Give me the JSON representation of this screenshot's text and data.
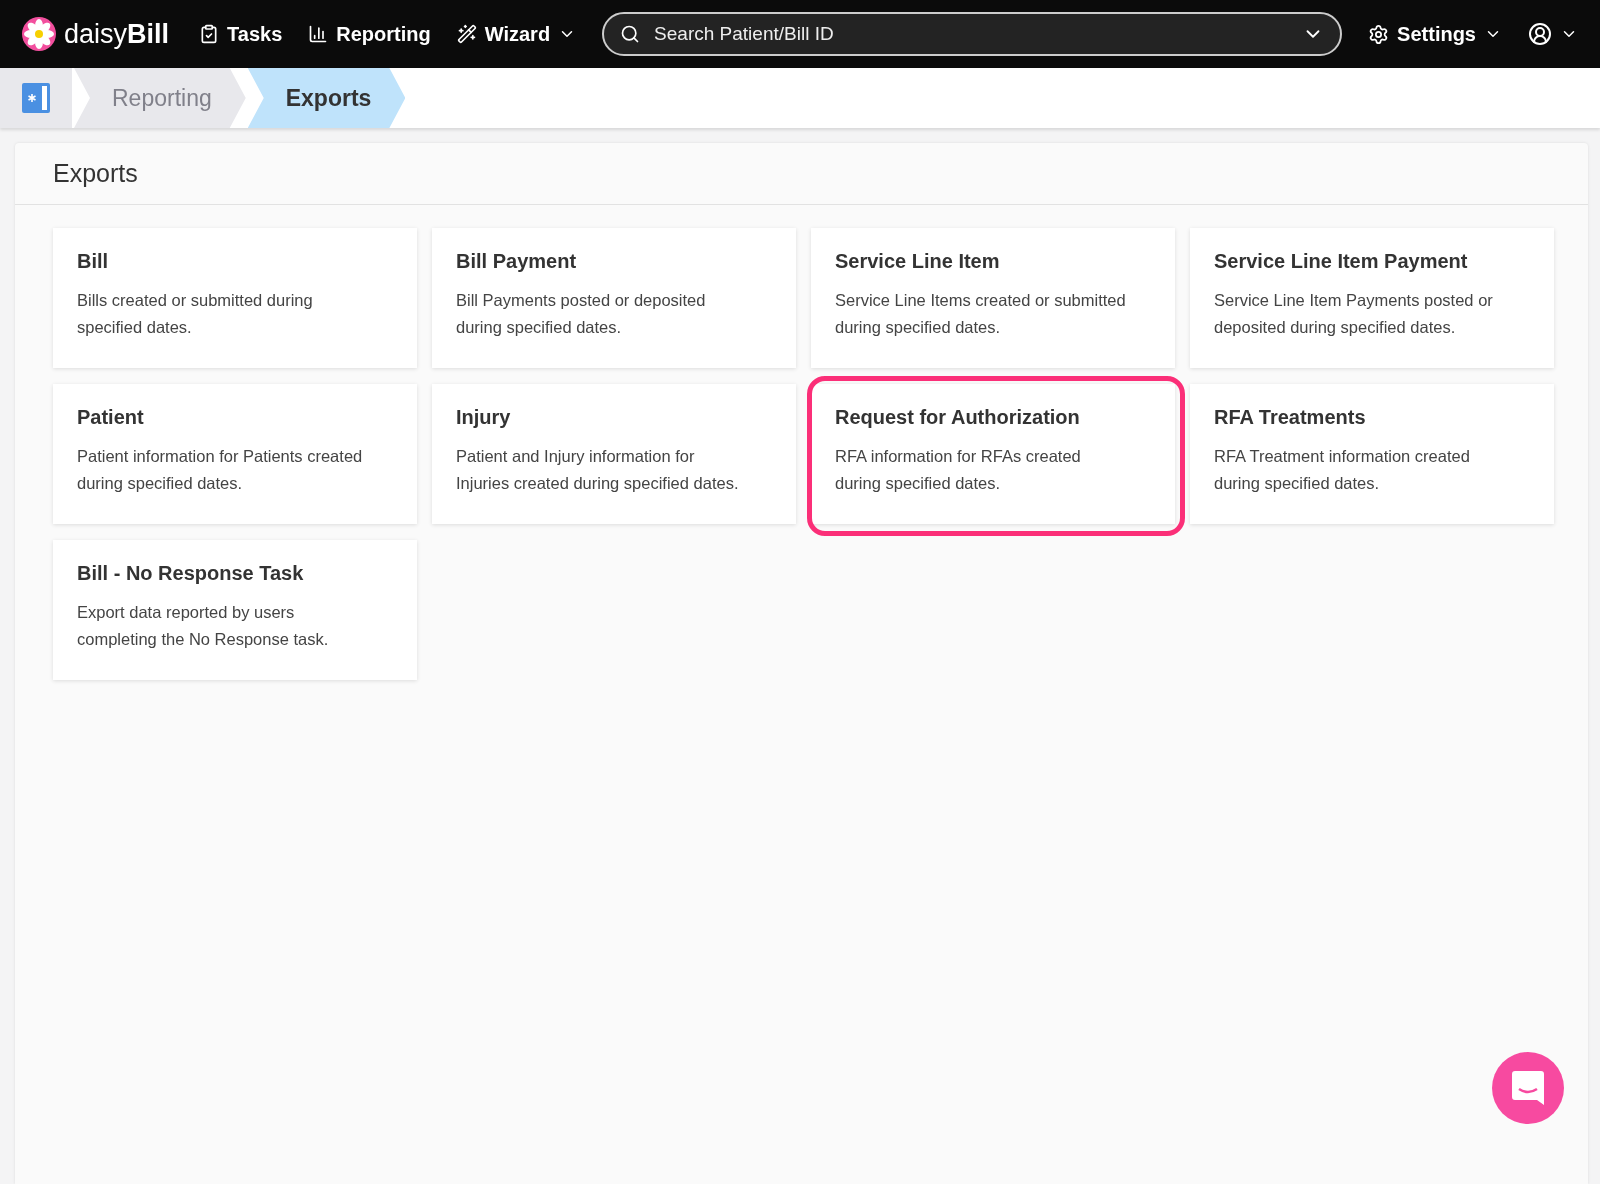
{
  "brand": {
    "light": "daisy",
    "bold": "Bill"
  },
  "nav": [
    {
      "label": "Tasks",
      "caret": false
    },
    {
      "label": "Reporting",
      "caret": false
    },
    {
      "label": "Wizard",
      "caret": true
    }
  ],
  "search": {
    "placeholder": "Search Patient/Bill ID"
  },
  "settings": {
    "label": "Settings"
  },
  "breadcrumbs": [
    {
      "label": "Reporting",
      "selected": false
    },
    {
      "label": "Exports",
      "selected": true
    }
  ],
  "panel": {
    "title": "Exports"
  },
  "cards": [
    {
      "title": "Bill",
      "description": "Bills created or submitted during specified dates.",
      "highlighted": false
    },
    {
      "title": "Bill Payment",
      "description": "Bill Payments posted or deposited during specified dates.",
      "highlighted": false
    },
    {
      "title": "Service Line Item",
      "description": "Service Line Items created or submitted during specified dates.",
      "highlighted": false
    },
    {
      "title": "Service Line Item Payment",
      "description": "Service Line Item Payments posted or deposited during specified dates.",
      "highlighted": false
    },
    {
      "title": "Patient",
      "description": "Patient information for Patients created during specified dates.",
      "highlighted": false
    },
    {
      "title": "Injury",
      "description": "Patient and Injury information for Injuries created during specified dates.",
      "highlighted": false
    },
    {
      "title": "Request for Authorization",
      "description": "RFA information for RFAs created during specified dates.",
      "highlighted": true
    },
    {
      "title": "RFA Treatments",
      "description": "RFA Treatment information created during specified dates.",
      "highlighted": false
    },
    {
      "title": "Bill - No Response Task",
      "description": "Export data reported by users completing the No Response task.",
      "highlighted": false
    }
  ]
}
